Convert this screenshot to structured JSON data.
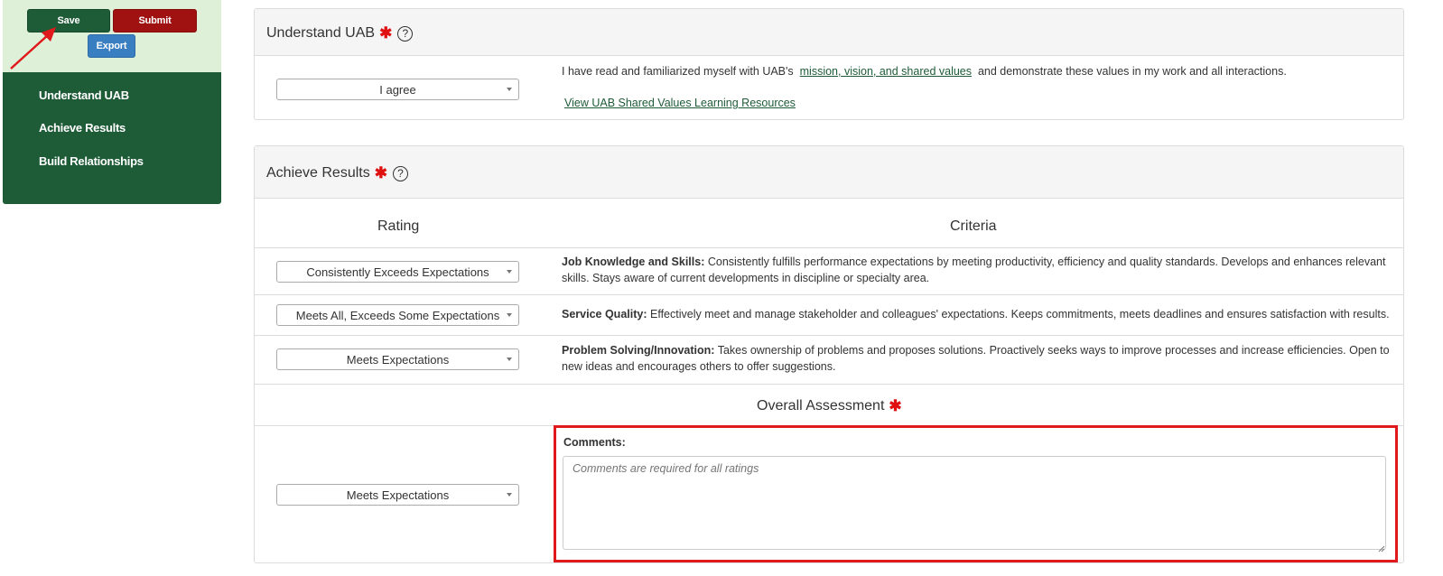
{
  "sidebar": {
    "buttons": {
      "save": "Save",
      "submit": "Submit",
      "export": "Export"
    },
    "nav": [
      "Understand UAB",
      "Achieve Results",
      "Build Relationships"
    ]
  },
  "understand": {
    "title": "Understand UAB",
    "required_mark": "✱",
    "help": "?",
    "select_value": "I agree",
    "text_before": "I have read and familiarized myself with UAB's",
    "link_mission": "mission, vision, and shared values",
    "text_after": "and demonstrate these values in my work and all interactions.",
    "link_resources": "View UAB Shared Values Learning Resources"
  },
  "achieve": {
    "title": "Achieve Results",
    "required_mark": "✱",
    "help": "?",
    "col_rating": "Rating",
    "col_criteria": "Criteria",
    "rows": [
      {
        "rating": "Consistently Exceeds Expectations",
        "label": "Job Knowledge and Skills:",
        "text": "Consistently fulfills performance expectations by meeting productivity, efficiency and quality standards. Develops and enhances relevant skills. Stays aware of current developments in discipline or specialty area."
      },
      {
        "rating": "Meets All, Exceeds Some Expectations",
        "label": "Service Quality:",
        "text": "Effectively meet and manage stakeholder and colleagues' expectations. Keeps commitments, meets deadlines and ensures satisfaction with results."
      },
      {
        "rating": "Meets Expectations",
        "label": "Problem Solving/Innovation:",
        "text": "Takes ownership of problems and proposes solutions. Proactively seeks ways to improve processes and increase efficiencies. Open to new ideas and encourages others to offer suggestions."
      }
    ],
    "overall_title": "Overall Assessment",
    "overall_rating": "Meets Expectations",
    "comments_label": "Comments:",
    "comments_placeholder": "Comments are required for all ratings",
    "comments_value": ""
  },
  "colors": {
    "brand_green": "#1e5b37",
    "submit_red": "#a01212",
    "export_blue": "#3a7ec2",
    "annotation_red": "#e0191c"
  }
}
